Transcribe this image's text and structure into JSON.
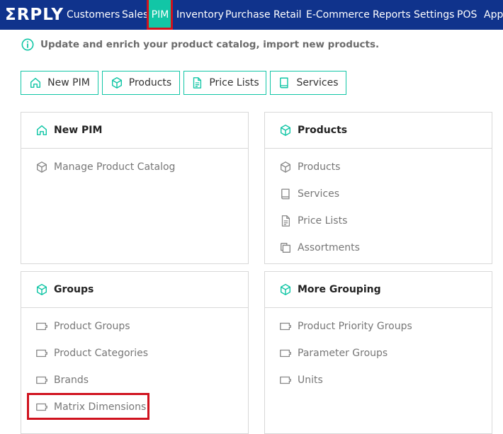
{
  "brand": {
    "logo": "ΣRPLY"
  },
  "nav": {
    "items": [
      "Customers",
      "Sales",
      "PIM",
      "Inventory",
      "Purchase",
      "Retail",
      "E-Commerce",
      "Reports",
      "Settings",
      "POS",
      "Apps"
    ],
    "active": "PIM"
  },
  "info_text": "Update and enrich your product catalog, import new products.",
  "tabs": [
    {
      "label": "New PIM",
      "icon": "home-icon"
    },
    {
      "label": "Products",
      "icon": "cube-icon"
    },
    {
      "label": "Price Lists",
      "icon": "document-icon"
    },
    {
      "label": "Services",
      "icon": "book-icon"
    }
  ],
  "cards": {
    "new_pim": {
      "title": "New PIM",
      "items": [
        "Manage Product Catalog"
      ]
    },
    "products": {
      "title": "Products",
      "items": [
        "Products",
        "Services",
        "Price Lists",
        "Assortments"
      ]
    },
    "groups": {
      "title": "Groups",
      "items": [
        "Product Groups",
        "Product Categories",
        "Brands",
        "Matrix Dimensions"
      ]
    },
    "more_grouping": {
      "title": "More Grouping",
      "items": [
        "Product Priority Groups",
        "Parameter Groups",
        "Units"
      ]
    }
  },
  "colors": {
    "nav_bg": "#10338c",
    "accent": "#12c6a6",
    "highlight": "#d0121e"
  }
}
